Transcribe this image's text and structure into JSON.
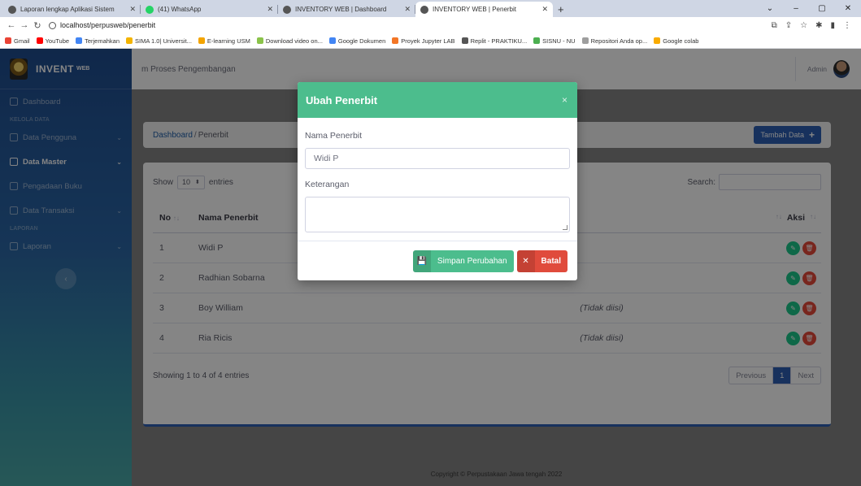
{
  "browser": {
    "tabs": [
      {
        "title": "Laporan lengkap Aplikasi Sistem",
        "active": false,
        "color": "#555555"
      },
      {
        "title": "(41) WhatsApp",
        "active": false,
        "color": "#25d366"
      },
      {
        "title": "INVENTORY WEB | Dashboard",
        "active": false,
        "color": "#555555"
      },
      {
        "title": "INVENTORY WEB | Penerbit",
        "active": true,
        "color": "#555555"
      }
    ],
    "url": "localhost/perpusweb/penerbit",
    "bookmarks": [
      "Gmail",
      "YouTube",
      "Terjemahkan",
      "SIMA 1.0| Universit...",
      "E-learning USM",
      "Download video on...",
      "Google Dokumen",
      "Proyek Jupyter LAB",
      "Replit - PRAKTIKU...",
      "SISNU - NU",
      "Repositori Anda op...",
      "Google colab"
    ]
  },
  "sidebar": {
    "brand": "INVENT",
    "brand_sup": "WEB",
    "items": [
      {
        "label": "Dashboard",
        "type": "item",
        "active": false,
        "chevron": false
      },
      {
        "label": "KELOLA DATA",
        "type": "heading"
      },
      {
        "label": "Data Pengguna",
        "type": "item",
        "active": false,
        "chevron": true
      },
      {
        "label": "Data Master",
        "type": "item",
        "active": true,
        "chevron": true
      },
      {
        "label": "Pengadaan Buku",
        "type": "item",
        "active": false,
        "chevron": false
      },
      {
        "label": "Data Transaksi",
        "type": "item",
        "active": false,
        "chevron": true
      },
      {
        "label": "LAPORAN",
        "type": "heading"
      },
      {
        "label": "Laporan",
        "type": "item",
        "active": false,
        "chevron": true
      }
    ]
  },
  "topbar": {
    "system_title": "m Proses Pengembangan",
    "user": "Admin"
  },
  "breadcrumb": {
    "link": "Dashboard",
    "separator": "/",
    "current": "Penerbit"
  },
  "add_button": {
    "label": "Tambah Data",
    "icon": "+"
  },
  "datatable": {
    "show": "Show",
    "length": "10",
    "entries": "entries",
    "search": "Search:",
    "columns": {
      "no": "No",
      "name": "Nama Penerbit",
      "aksi": "Aksi"
    },
    "rows": [
      {
        "no": "1",
        "name": "Widi P",
        "ket": ""
      },
      {
        "no": "2",
        "name": "Radhian Sobarna",
        "ket": ""
      },
      {
        "no": "3",
        "name": "Boy William",
        "ket": "(Tidak diisi)"
      },
      {
        "no": "4",
        "name": "Ria Ricis",
        "ket": "(Tidak diisi)"
      }
    ],
    "info": "Showing 1 to 4 of 4 entries",
    "pager": {
      "prev": "Previous",
      "current": "1",
      "next": "Next"
    }
  },
  "footer": "Copyright © Perpustakaan Jawa tengah 2022",
  "modal": {
    "title": "Ubah Penerbit",
    "close": "×",
    "name_label": "Nama Penerbit",
    "name_value": "Widi P",
    "note_label": "Keterangan",
    "note_value": "",
    "save_label": "Simpan Perubahan",
    "cancel_label": "Batal"
  },
  "colors": {
    "modal_header": "#4cbd8d",
    "primary": "#2d5fb3",
    "danger": "#e04b3c",
    "success": "#1cc88a"
  }
}
